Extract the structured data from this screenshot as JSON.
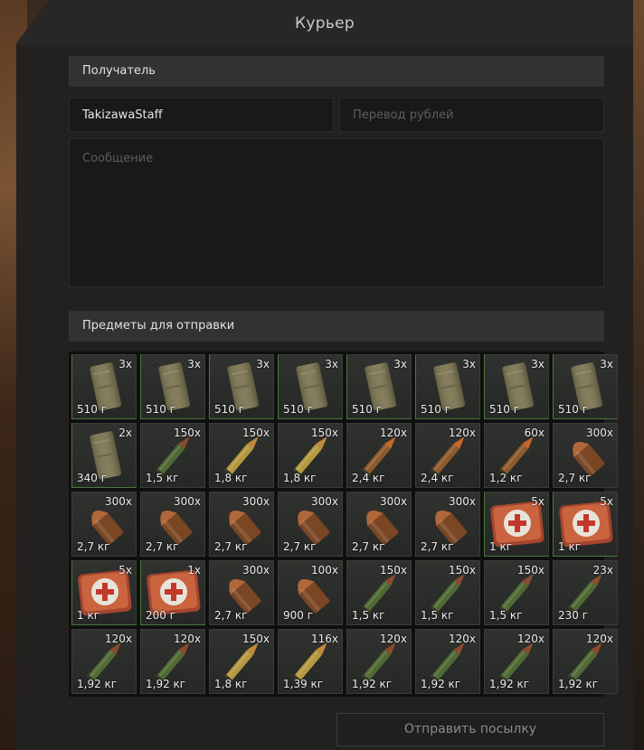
{
  "window": {
    "title": "Курьер"
  },
  "recipient": {
    "header": "Получатель",
    "name_value": "TakizawaStaff",
    "rubles_placeholder": "Перевод рублей",
    "message_placeholder": "Сообщение"
  },
  "items": {
    "header": "Предметы для отправки",
    "list": [
      {
        "type": "canister",
        "qty": "3x",
        "weight": "510 г"
      },
      {
        "type": "canister",
        "qty": "3x",
        "weight": "510 г"
      },
      {
        "type": "canister",
        "qty": "3x",
        "weight": "510 г"
      },
      {
        "type": "canister",
        "qty": "3x",
        "weight": "510 г"
      },
      {
        "type": "canister",
        "qty": "3x",
        "weight": "510 г"
      },
      {
        "type": "canister",
        "qty": "3x",
        "weight": "510 г"
      },
      {
        "type": "canister",
        "qty": "3x",
        "weight": "510 г"
      },
      {
        "type": "canister",
        "qty": "3x",
        "weight": "510 г"
      },
      {
        "type": "canister",
        "qty": "2x",
        "weight": "340 г"
      },
      {
        "type": "rifle-round-green",
        "qty": "150x",
        "weight": "1,5 кг"
      },
      {
        "type": "rifle-round-brass",
        "qty": "150x",
        "weight": "1,8 кг"
      },
      {
        "type": "rifle-round-brass",
        "qty": "150x",
        "weight": "1,8 кг"
      },
      {
        "type": "rifle-round-copper",
        "qty": "120x",
        "weight": "2,4 кг"
      },
      {
        "type": "rifle-round-copper",
        "qty": "120x",
        "weight": "2,4 кг"
      },
      {
        "type": "rifle-round-copper",
        "qty": "60x",
        "weight": "1,2 кг"
      },
      {
        "type": "pistol-round",
        "qty": "300x",
        "weight": "2,7 кг"
      },
      {
        "type": "pistol-round",
        "qty": "300x",
        "weight": "2,7 кг"
      },
      {
        "type": "pistol-round",
        "qty": "300x",
        "weight": "2,7 кг"
      },
      {
        "type": "pistol-round",
        "qty": "300x",
        "weight": "2,7 кг"
      },
      {
        "type": "pistol-round",
        "qty": "300x",
        "weight": "2,7 кг"
      },
      {
        "type": "pistol-round",
        "qty": "300x",
        "weight": "2,7 кг"
      },
      {
        "type": "pistol-round",
        "qty": "300x",
        "weight": "2,7 кг"
      },
      {
        "type": "medkit",
        "qty": "5x",
        "weight": "1 кг"
      },
      {
        "type": "medkit",
        "qty": "5x",
        "weight": "1 кг"
      },
      {
        "type": "medkit",
        "qty": "5x",
        "weight": "1 кг"
      },
      {
        "type": "medkit",
        "qty": "1x",
        "weight": "200 г"
      },
      {
        "type": "pistol-round",
        "qty": "300x",
        "weight": "2,7 кг"
      },
      {
        "type": "pistol-round",
        "qty": "100x",
        "weight": "900 г"
      },
      {
        "type": "rifle-round-green",
        "qty": "150x",
        "weight": "1,5 кг"
      },
      {
        "type": "rifle-round-green",
        "qty": "150x",
        "weight": "1,5 кг"
      },
      {
        "type": "rifle-round-green",
        "qty": "150x",
        "weight": "1,5 кг"
      },
      {
        "type": "rifle-round-green",
        "qty": "23x",
        "weight": "230 г"
      },
      {
        "type": "rifle-round-green",
        "qty": "120x",
        "weight": "1,92 кг"
      },
      {
        "type": "rifle-round-green",
        "qty": "120x",
        "weight": "1,92 кг"
      },
      {
        "type": "rifle-round-brass",
        "qty": "150x",
        "weight": "1,8 кг"
      },
      {
        "type": "rifle-round-brass",
        "qty": "116x",
        "weight": "1,39 кг"
      },
      {
        "type": "rifle-round-green",
        "qty": "120x",
        "weight": "1,92 кг"
      },
      {
        "type": "rifle-round-green",
        "qty": "120x",
        "weight": "1,92 кг"
      },
      {
        "type": "rifle-round-green",
        "qty": "120x",
        "weight": "1,92 кг"
      },
      {
        "type": "rifle-round-green",
        "qty": "120x",
        "weight": "1,92 кг"
      }
    ]
  },
  "actions": {
    "send_label": "Отправить посылку"
  },
  "colors": {
    "panel": "#222120",
    "section_header": "#333231",
    "input_bg": "#191919",
    "cell_bg": "#2b2d2a",
    "medkit_red": "#c64a3a"
  }
}
